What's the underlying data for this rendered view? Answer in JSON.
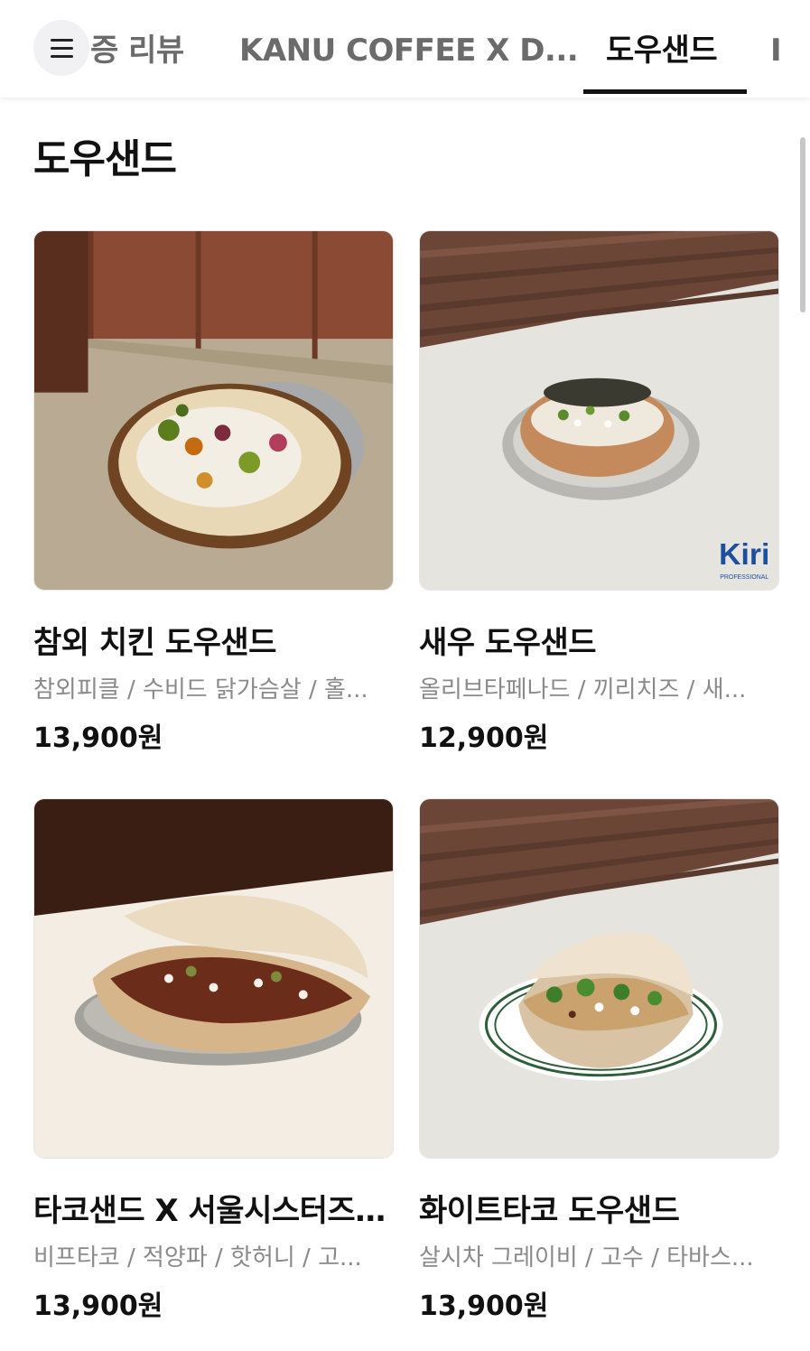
{
  "tabs": [
    {
      "label": "증 리뷰",
      "active": false
    },
    {
      "label": "KANU COFFEE X D...",
      "active": false
    },
    {
      "label": "도우샌드",
      "active": true
    },
    {
      "label": "I",
      "active": false
    }
  ],
  "menu_icon": "hamburger-menu-icon",
  "section_title": "도우샌드",
  "products": [
    {
      "name": "참외 치킨 도우샌드",
      "desc": "참외피클 / 수비드 닭가슴살 / 홀...",
      "price": "13,900원",
      "image": "chamoe-chicken-dough-sandwich-photo"
    },
    {
      "name": "새우 도우샌드",
      "desc": "올리브타페나드 / 끼리치즈 / 새...",
      "price": "12,900원",
      "image": "shrimp-dough-sandwich-photo",
      "badge": "Kiri",
      "badge_sub": "PROFESSIONAL"
    },
    {
      "name": "타코샌드 X 서울시스터즈 ...",
      "desc": "비프타코 / 적양파 / 핫허니 / 고...",
      "price": "13,900원",
      "image": "taco-sand-dough-sandwich-photo"
    },
    {
      "name": "화이트타코 도우샌드",
      "desc": "살시차 그레이비 / 고수 / 타바스...",
      "price": "13,900원",
      "image": "white-taco-dough-sandwich-photo"
    }
  ],
  "colors": {
    "text_primary": "#111111",
    "text_secondary": "#8a8a8a",
    "tab_inactive": "#6b6b6b",
    "indicator": "#111111"
  }
}
